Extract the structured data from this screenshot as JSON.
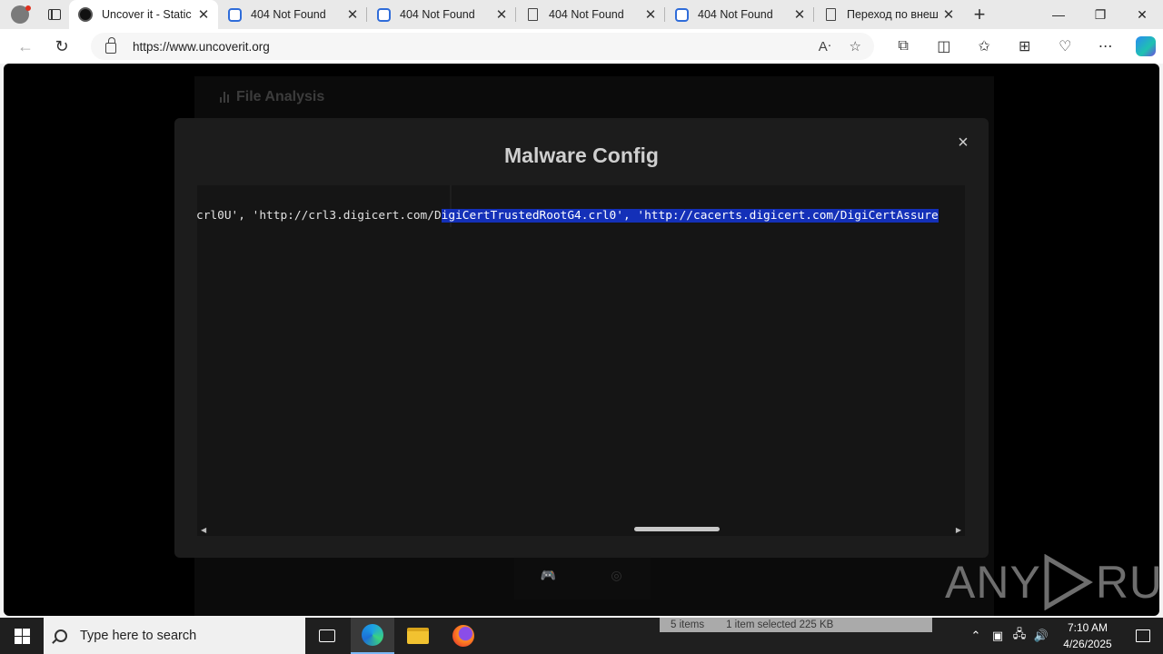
{
  "browser": {
    "tabs": [
      {
        "title": "Uncover it - Static",
        "favicon": "uncoverit-icon",
        "active": true
      },
      {
        "title": "404 Not Found",
        "favicon": "blue-cube-icon",
        "active": false
      },
      {
        "title": "404 Not Found",
        "favicon": "blue-cube-icon",
        "active": false
      },
      {
        "title": "404 Not Found",
        "favicon": "document-icon",
        "active": false
      },
      {
        "title": "404 Not Found",
        "favicon": "blue-cube-icon",
        "active": false
      },
      {
        "title": "Переход по внеш",
        "favicon": "document-icon",
        "active": false
      }
    ],
    "url": "https://www.uncoverit.org"
  },
  "page": {
    "section_title": "File Analysis"
  },
  "modal": {
    "title": "Malware Config",
    "close_symbol": "×",
    "code_plain": "crl0U', 'http://crl3.digicert.com/D",
    "code_selected": "igiCertTrustedRootG4.crl0', 'http://cacerts.digicert.com/DigiCertAssure",
    "scroll_fraction": 0.57
  },
  "watermark": {
    "left": "ANY",
    "right": "RUN"
  },
  "taskbar": {
    "search_placeholder": "Type here to search",
    "explorer_status": [
      "5 items",
      "1 item selected  225 KB"
    ],
    "time": "7:10 AM",
    "date": "4/26/2025"
  },
  "colors": {
    "selection": "#1430b8",
    "modal_bg": "#1c1c1c",
    "taskbar_bg": "#1f1f1f"
  }
}
